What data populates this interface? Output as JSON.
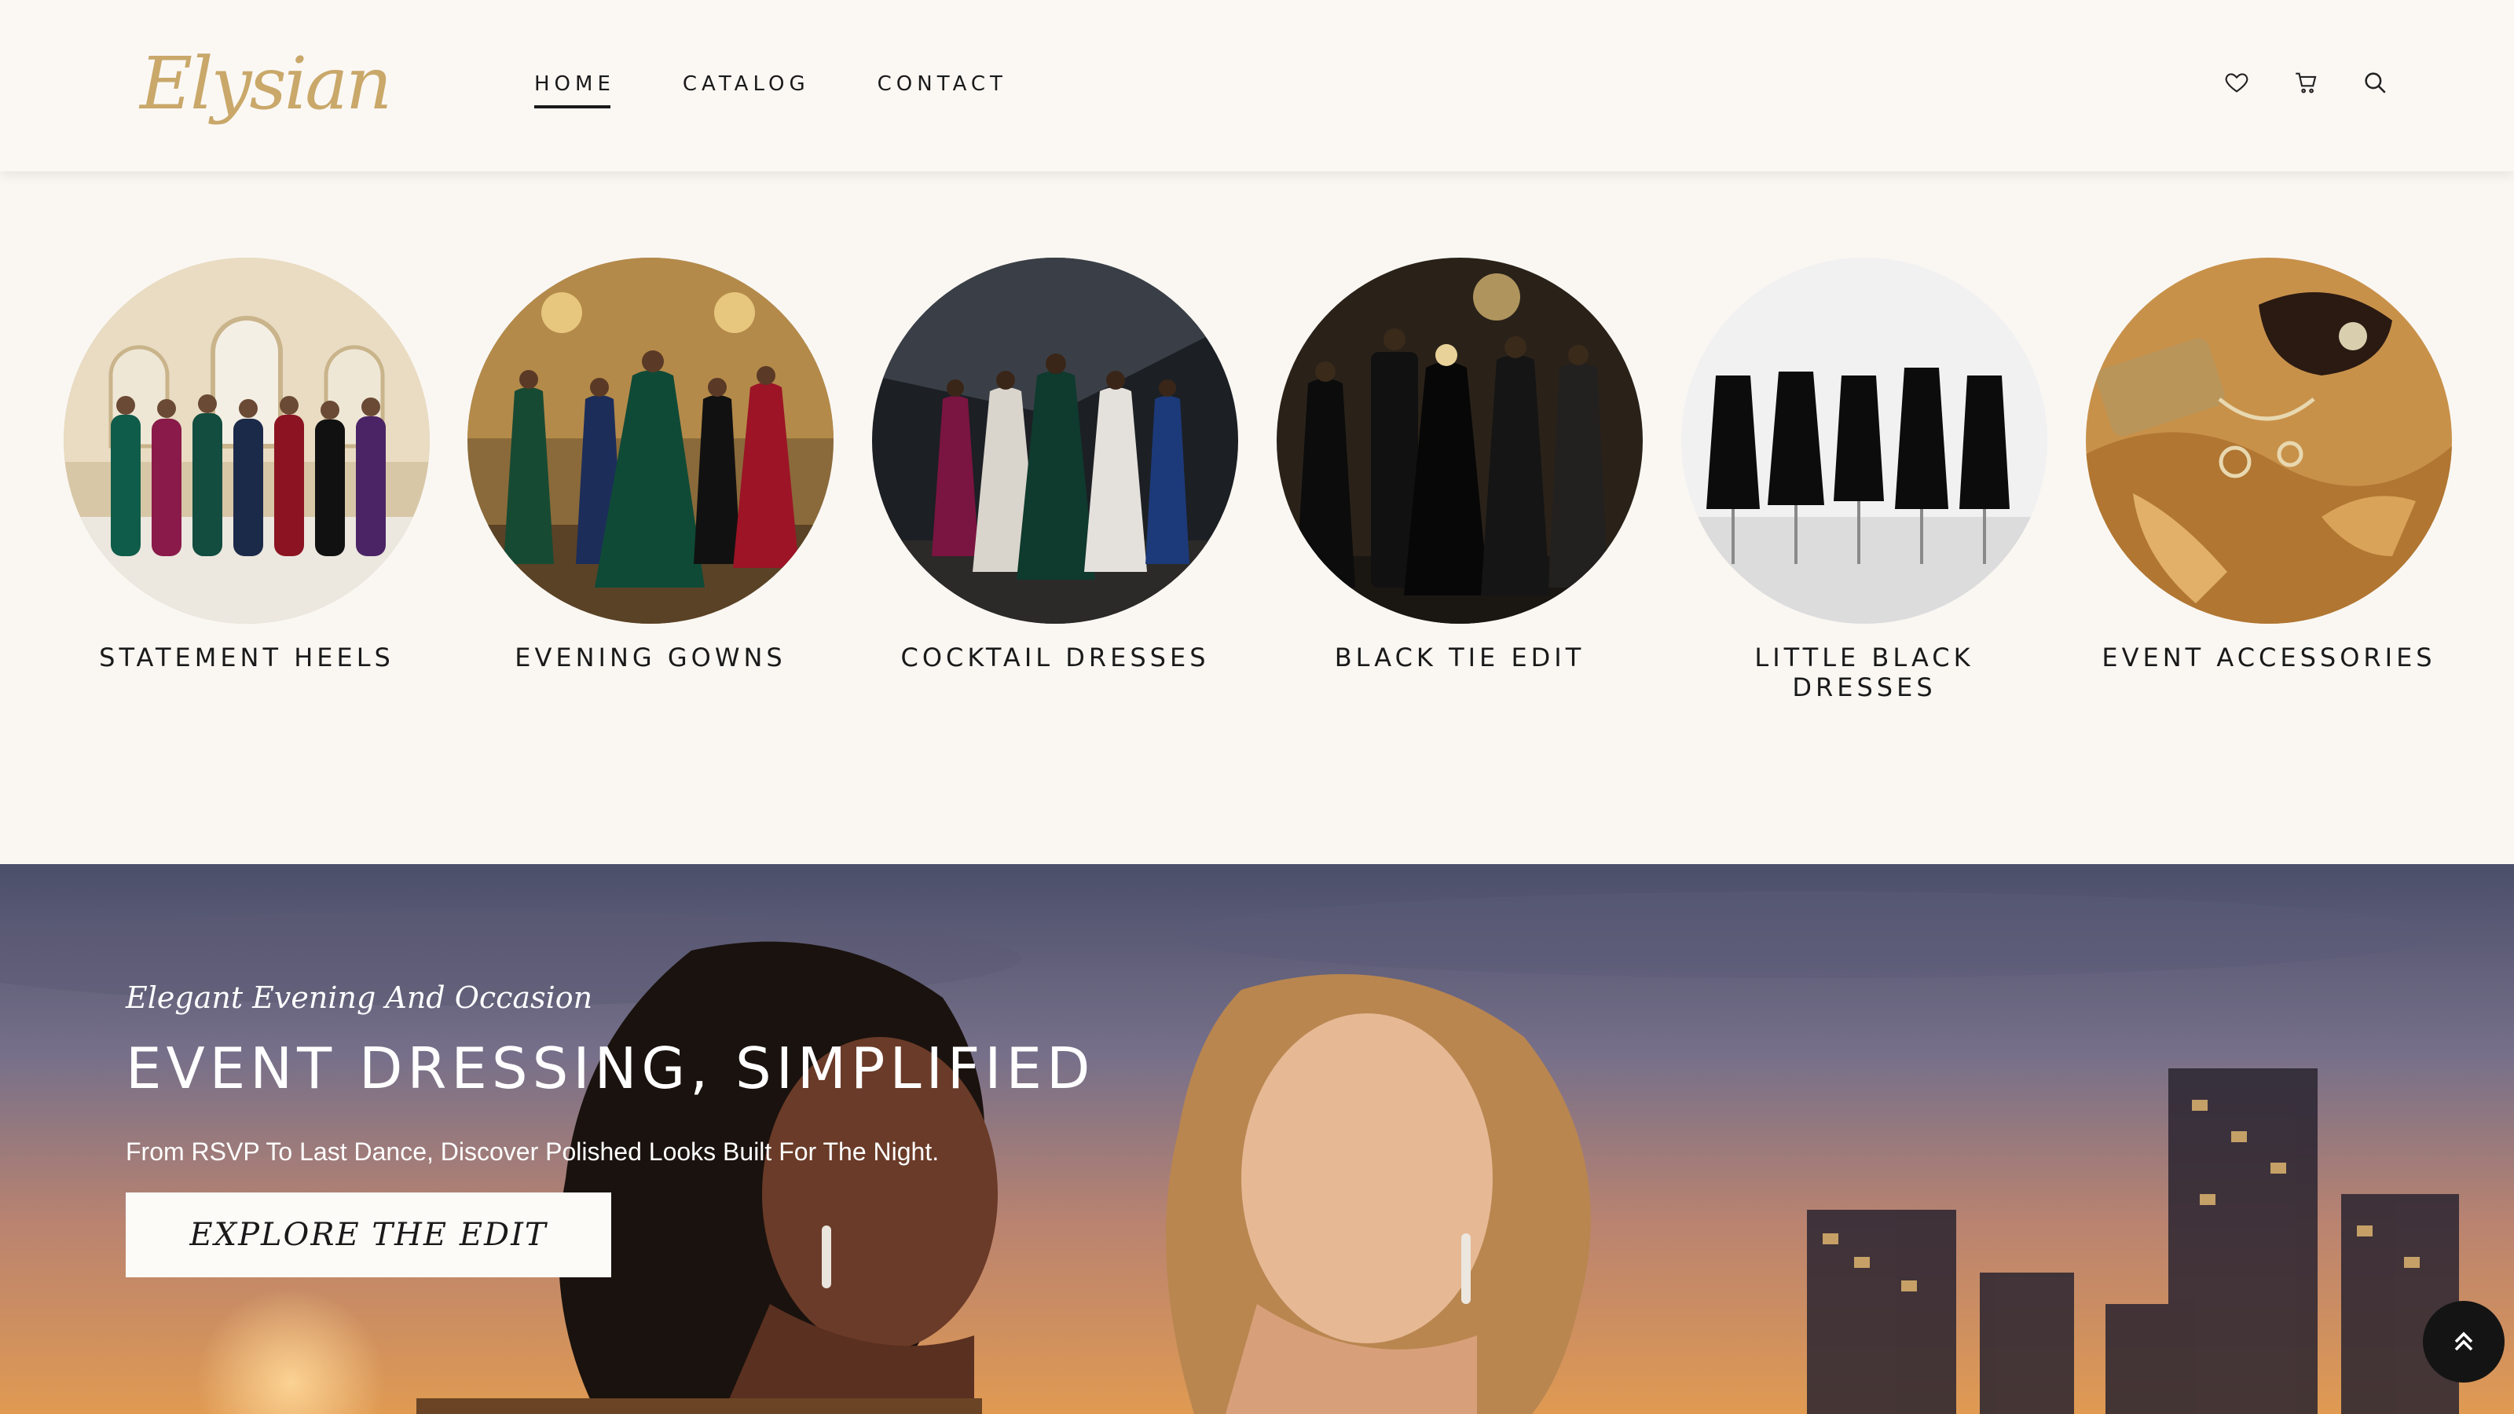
{
  "brand": {
    "logo_text": "Elysian"
  },
  "nav": {
    "items": [
      {
        "label": "HOME",
        "active": true
      },
      {
        "label": "CATALOG",
        "active": false
      },
      {
        "label": "CONTACT",
        "active": false
      }
    ]
  },
  "header_icons": [
    "heart-icon",
    "cart-icon",
    "search-icon"
  ],
  "categories": [
    {
      "label": "STATEMENT HEELS"
    },
    {
      "label": "EVENING GOWNS"
    },
    {
      "label": "COCKTAIL DRESSES"
    },
    {
      "label": "BLACK TIE EDIT"
    },
    {
      "label": "LITTLE BLACK DRESSES"
    },
    {
      "label": "EVENT ACCESSORIES"
    }
  ],
  "hero": {
    "subtitle": "Elegant Evening And Occasion",
    "title": "EVENT DRESSING, SIMPLIFIED",
    "description": "From RSVP To Last Dance, Discover Polished Looks Built For The Night.",
    "button_label": "EXPLORE THE EDIT"
  },
  "colors": {
    "background": "#faf7f3",
    "logo_gold": "#c9a86a",
    "text_dark": "#1a1a1a",
    "scroll_top_bg": "#141414"
  }
}
